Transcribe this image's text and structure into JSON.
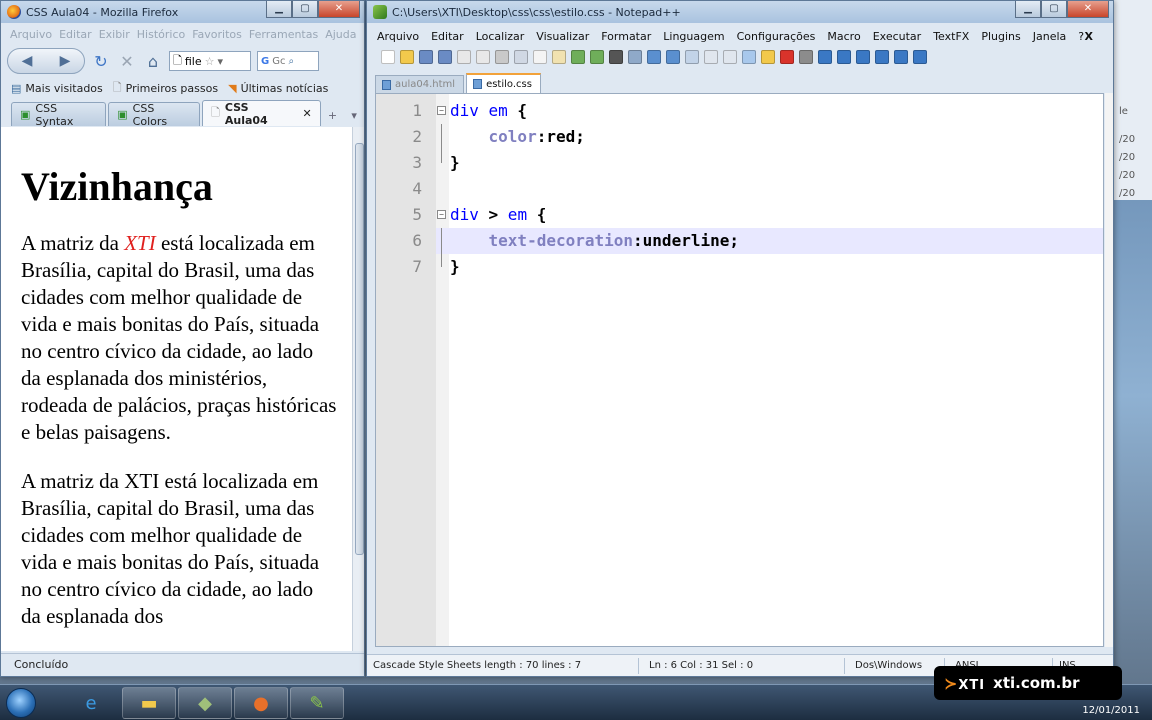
{
  "firefox": {
    "title": "CSS Aula04 - Mozilla Firefox",
    "menu": [
      "Arquivo",
      "Editar",
      "Exibir",
      "Histórico",
      "Favoritos",
      "Ferramentas",
      "Ajuda"
    ],
    "url": "file",
    "search_placeholder": "Gc",
    "bookmarks": [
      "Mais visitados",
      "Primeiros passos",
      "Últimas notícias"
    ],
    "tabs": [
      "CSS Syntax",
      "CSS Colors",
      "CSS Aula04"
    ],
    "heading": "Vizinhança",
    "p1_before": "A matriz da ",
    "p1_em": "XTI",
    "p1_after": " está localizada em Brasília, capital do Brasil, uma das cidades com melhor qualidade de vida e mais bonitas do País, situada no centro cívico da cidade, ao lado da esplanada dos ministérios, rodeada de palácios, praças históricas e belas paisagens.",
    "p2": "A matriz da XTI está localizada em Brasília, capital do Brasil, uma das cidades com melhor qualidade de vida e mais bonitas do País, situada no centro cívico da cidade, ao lado da esplanada dos",
    "status": "Concluído"
  },
  "notepad": {
    "title": "C:\\Users\\XTI\\Desktop\\css\\css\\estilo.css - Notepad++",
    "menu": [
      "Arquivo",
      "Editar",
      "Localizar",
      "Visualizar",
      "Formatar",
      "Linguagem",
      "Configurações",
      "Macro",
      "Executar",
      "TextFX",
      "Plugins",
      "Janela",
      "?"
    ],
    "menu_close": "X",
    "tabs": [
      "aula04.html",
      "estilo.css"
    ],
    "line_numbers": [
      "1",
      "2",
      "3",
      "4",
      "5",
      "6",
      "7"
    ],
    "code": {
      "l1_sel": "div em",
      "l1_brace": " {",
      "l2_prop": "color",
      "l2_val": ":red;",
      "l3": "}",
      "l5_sel": "div",
      "l5_gt": " >",
      "l5_sel2": " em",
      "l5_brace": " {",
      "l6_prop": "text-decoration",
      "l6_val": ":underline;",
      "l7": "}"
    },
    "status": {
      "lang": "Cascade Style Sheets length : 70   lines : 7",
      "pos": "Ln : 6   Col : 31   Sel : 0",
      "eol": "Dos\\Windows",
      "enc": "ANSI",
      "mode": "INS"
    }
  },
  "background_window": {
    "lines": [
      "le",
      "/20",
      "/20",
      "/20",
      "/20"
    ]
  },
  "taskbar": {
    "date": "12/01/2011"
  },
  "watermark": {
    "mark": "XTI",
    "site": "xti.com.br"
  }
}
